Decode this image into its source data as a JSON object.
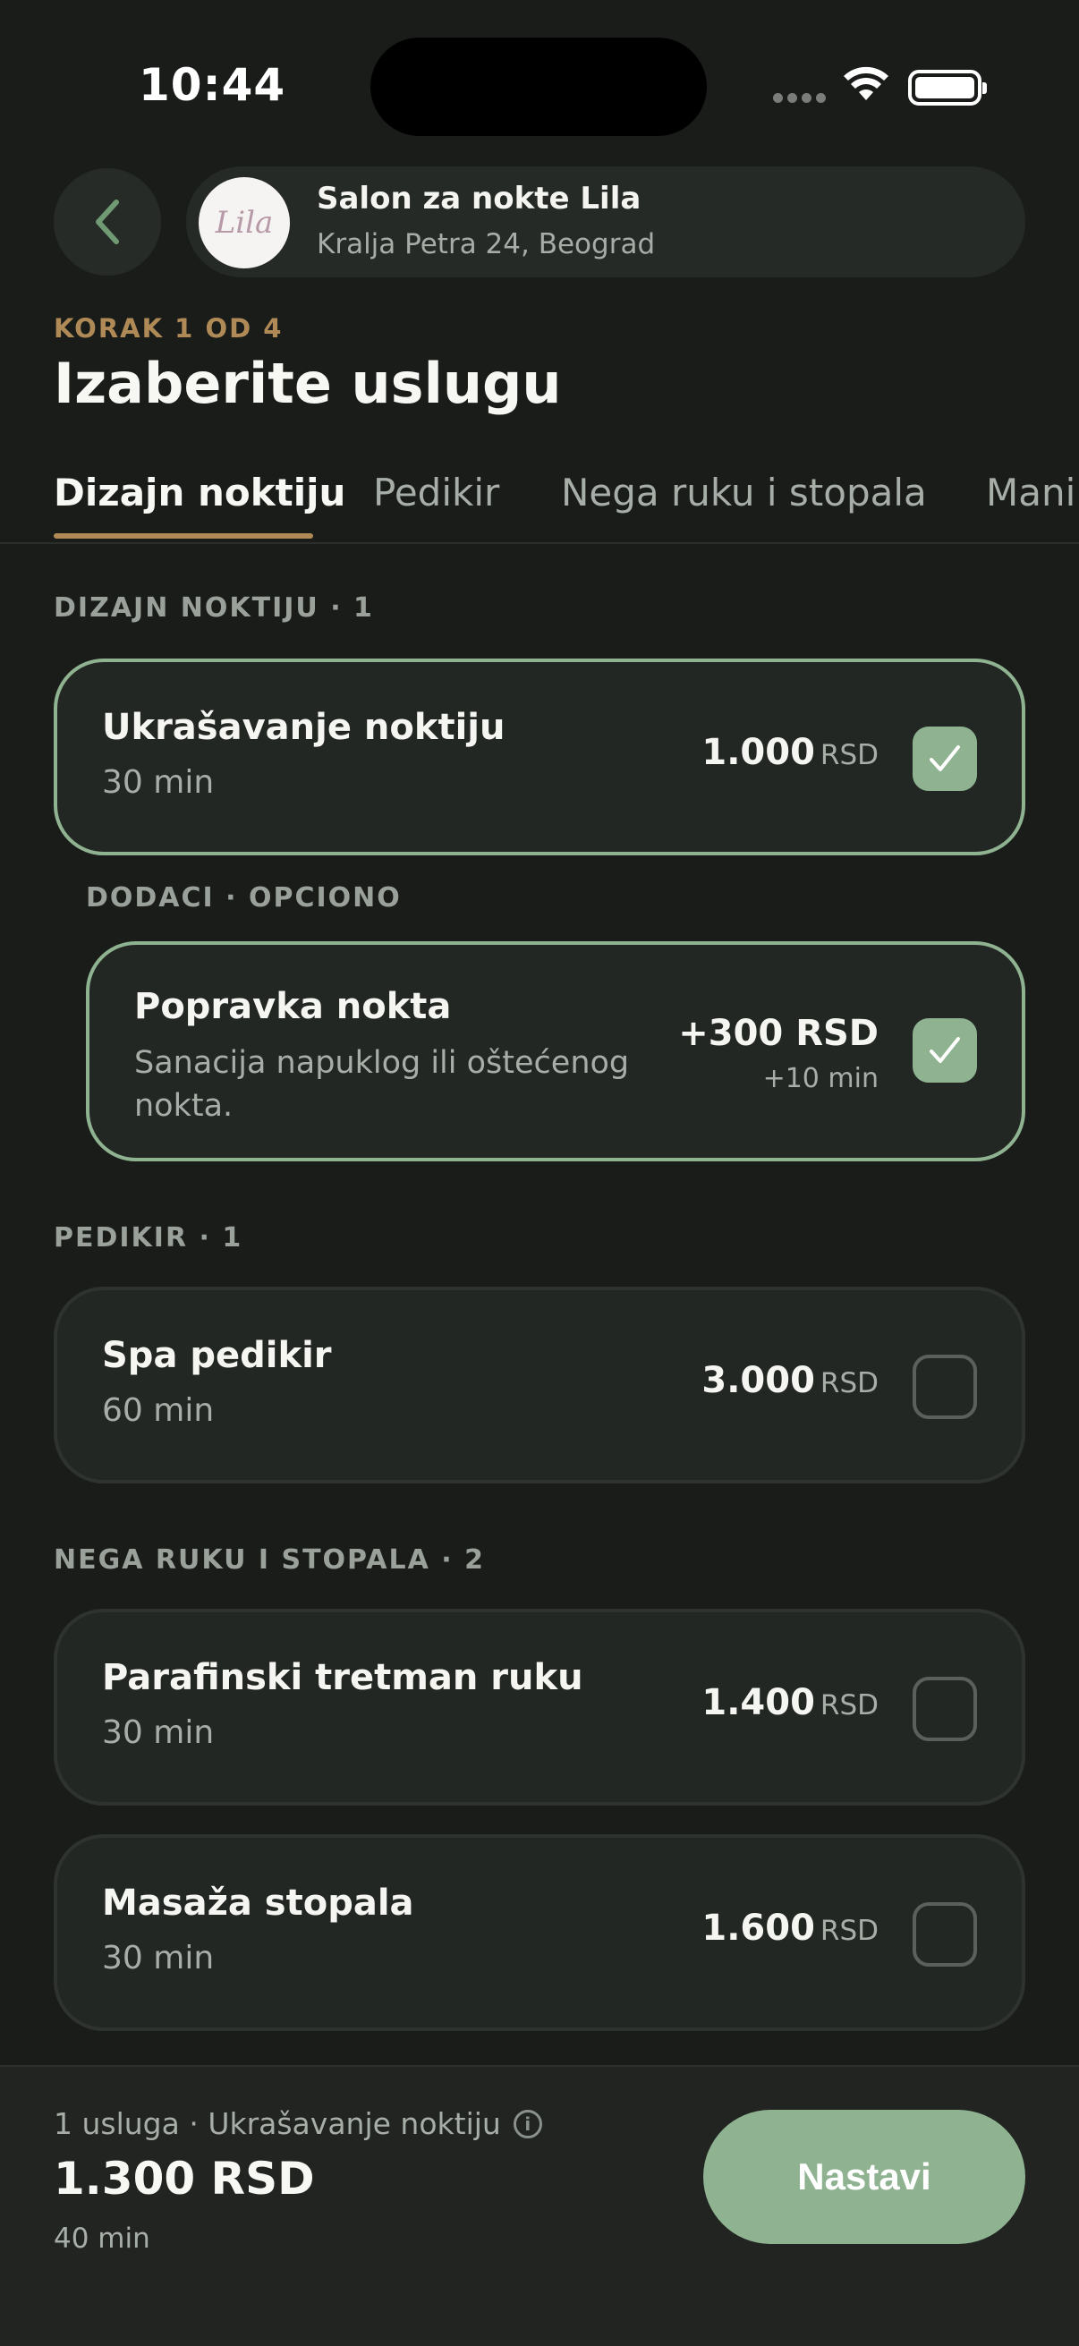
{
  "status_bar": {
    "time": "10:44"
  },
  "header": {
    "salon_name": "Salon za nokte Lila",
    "salon_address": "Kralja Petra 24, Beograd",
    "logo_text": "Lila",
    "icons": {
      "back": "chevron-left-icon",
      "wifi": "wifi-icon",
      "battery": "battery-icon"
    }
  },
  "step_label": "KORAK 1 OD 4",
  "page_title": "Izaberite uslugu",
  "tabs": [
    {
      "label": "Dizajn noktiju",
      "active": true
    },
    {
      "label": "Pedikir",
      "active": false
    },
    {
      "label": "Nega ruku i stopala",
      "active": false
    },
    {
      "label": "Mani",
      "active": false
    }
  ],
  "sections": [
    {
      "title": "DIZAJN NOKTIJU · 1",
      "services": [
        {
          "name": "Ukrašavanje noktiju",
          "duration": "30 min",
          "price": "1.000",
          "currency": "RSD",
          "selected": true
        }
      ],
      "addons": {
        "title": "DODACI · OPCIONO",
        "items": [
          {
            "name": "Popravka nokta",
            "description": "Sanacija napuklog ili oštećenog nokta.",
            "price": "+300 RSD",
            "extra_time": "+10 min",
            "selected": true
          }
        ]
      }
    },
    {
      "title": "PEDIKIR · 1",
      "services": [
        {
          "name": "Spa pedikir",
          "duration": "60 min",
          "price": "3.000",
          "currency": "RSD",
          "selected": false
        }
      ]
    },
    {
      "title": "NEGA RUKU I STOPALA · 2",
      "services": [
        {
          "name": "Parafinski tretman ruku",
          "duration": "30 min",
          "price": "1.400",
          "currency": "RSD",
          "selected": false
        },
        {
          "name": "Masaža stopala",
          "duration": "30 min",
          "price": "1.600",
          "currency": "RSD",
          "selected": false
        }
      ]
    }
  ],
  "summary": {
    "line": "1 usluga · Ukrašavanje noktiju",
    "info_icon": "info-icon",
    "total": "1.300 RSD",
    "total_time": "40 min",
    "continue_label": "Nastavi"
  },
  "colors": {
    "accent_green": "#8fb391",
    "accent_gold": "#b08a56",
    "background": "#1a1c1a"
  }
}
